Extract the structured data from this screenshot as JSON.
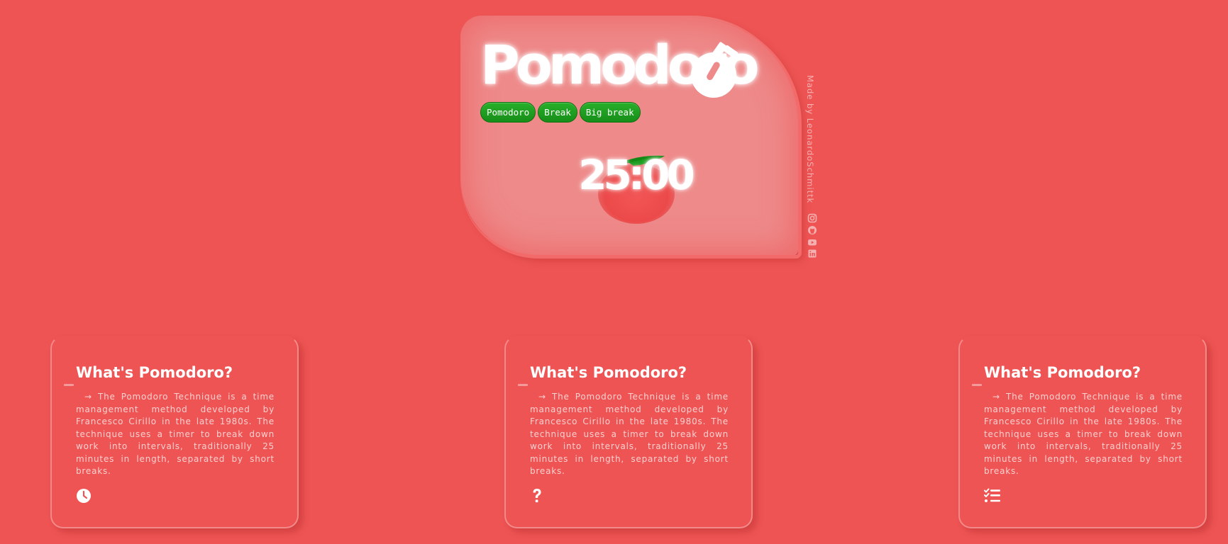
{
  "app": {
    "title": "Pomodoro",
    "modes": [
      "Pomodoro",
      "Break",
      "Big break"
    ],
    "timer": "25:00"
  },
  "credit": {
    "text": "Made by LeonardoSchmittk",
    "social_icons": [
      "instagram-icon",
      "github-icon",
      "youtube-icon",
      "linkedin-icon"
    ]
  },
  "cards": [
    {
      "title": "What's Pomodoro?",
      "body": "→ The Pomodoro Technique is a time management method developed by Francesco Cirillo in the late 1980s. The technique uses a timer to break down work into intervals, traditionally 25 minutes in length, separated by short breaks.",
      "icon": "clock-icon"
    },
    {
      "title": "What's Pomodoro?",
      "body": "→ The Pomodoro Technique is a time management method developed by Francesco Cirillo in the late 1980s. The technique uses a timer to break down work into intervals, traditionally 25 minutes in length, separated by short breaks.",
      "icon": "question-icon"
    },
    {
      "title": "What's Pomodoro?",
      "body": "→ The Pomodoro Technique is a time management method developed by Francesco Cirillo in the late 1980s. The technique uses a timer to break down work into intervals, traditionally 25 minutes in length, separated by short breaks.",
      "icon": "task-list-icon"
    }
  ],
  "colors": {
    "background": "#ee5454",
    "panel": "#ee8a8a",
    "button_green": "#1f9e21",
    "leaf_green": "#138a14"
  }
}
